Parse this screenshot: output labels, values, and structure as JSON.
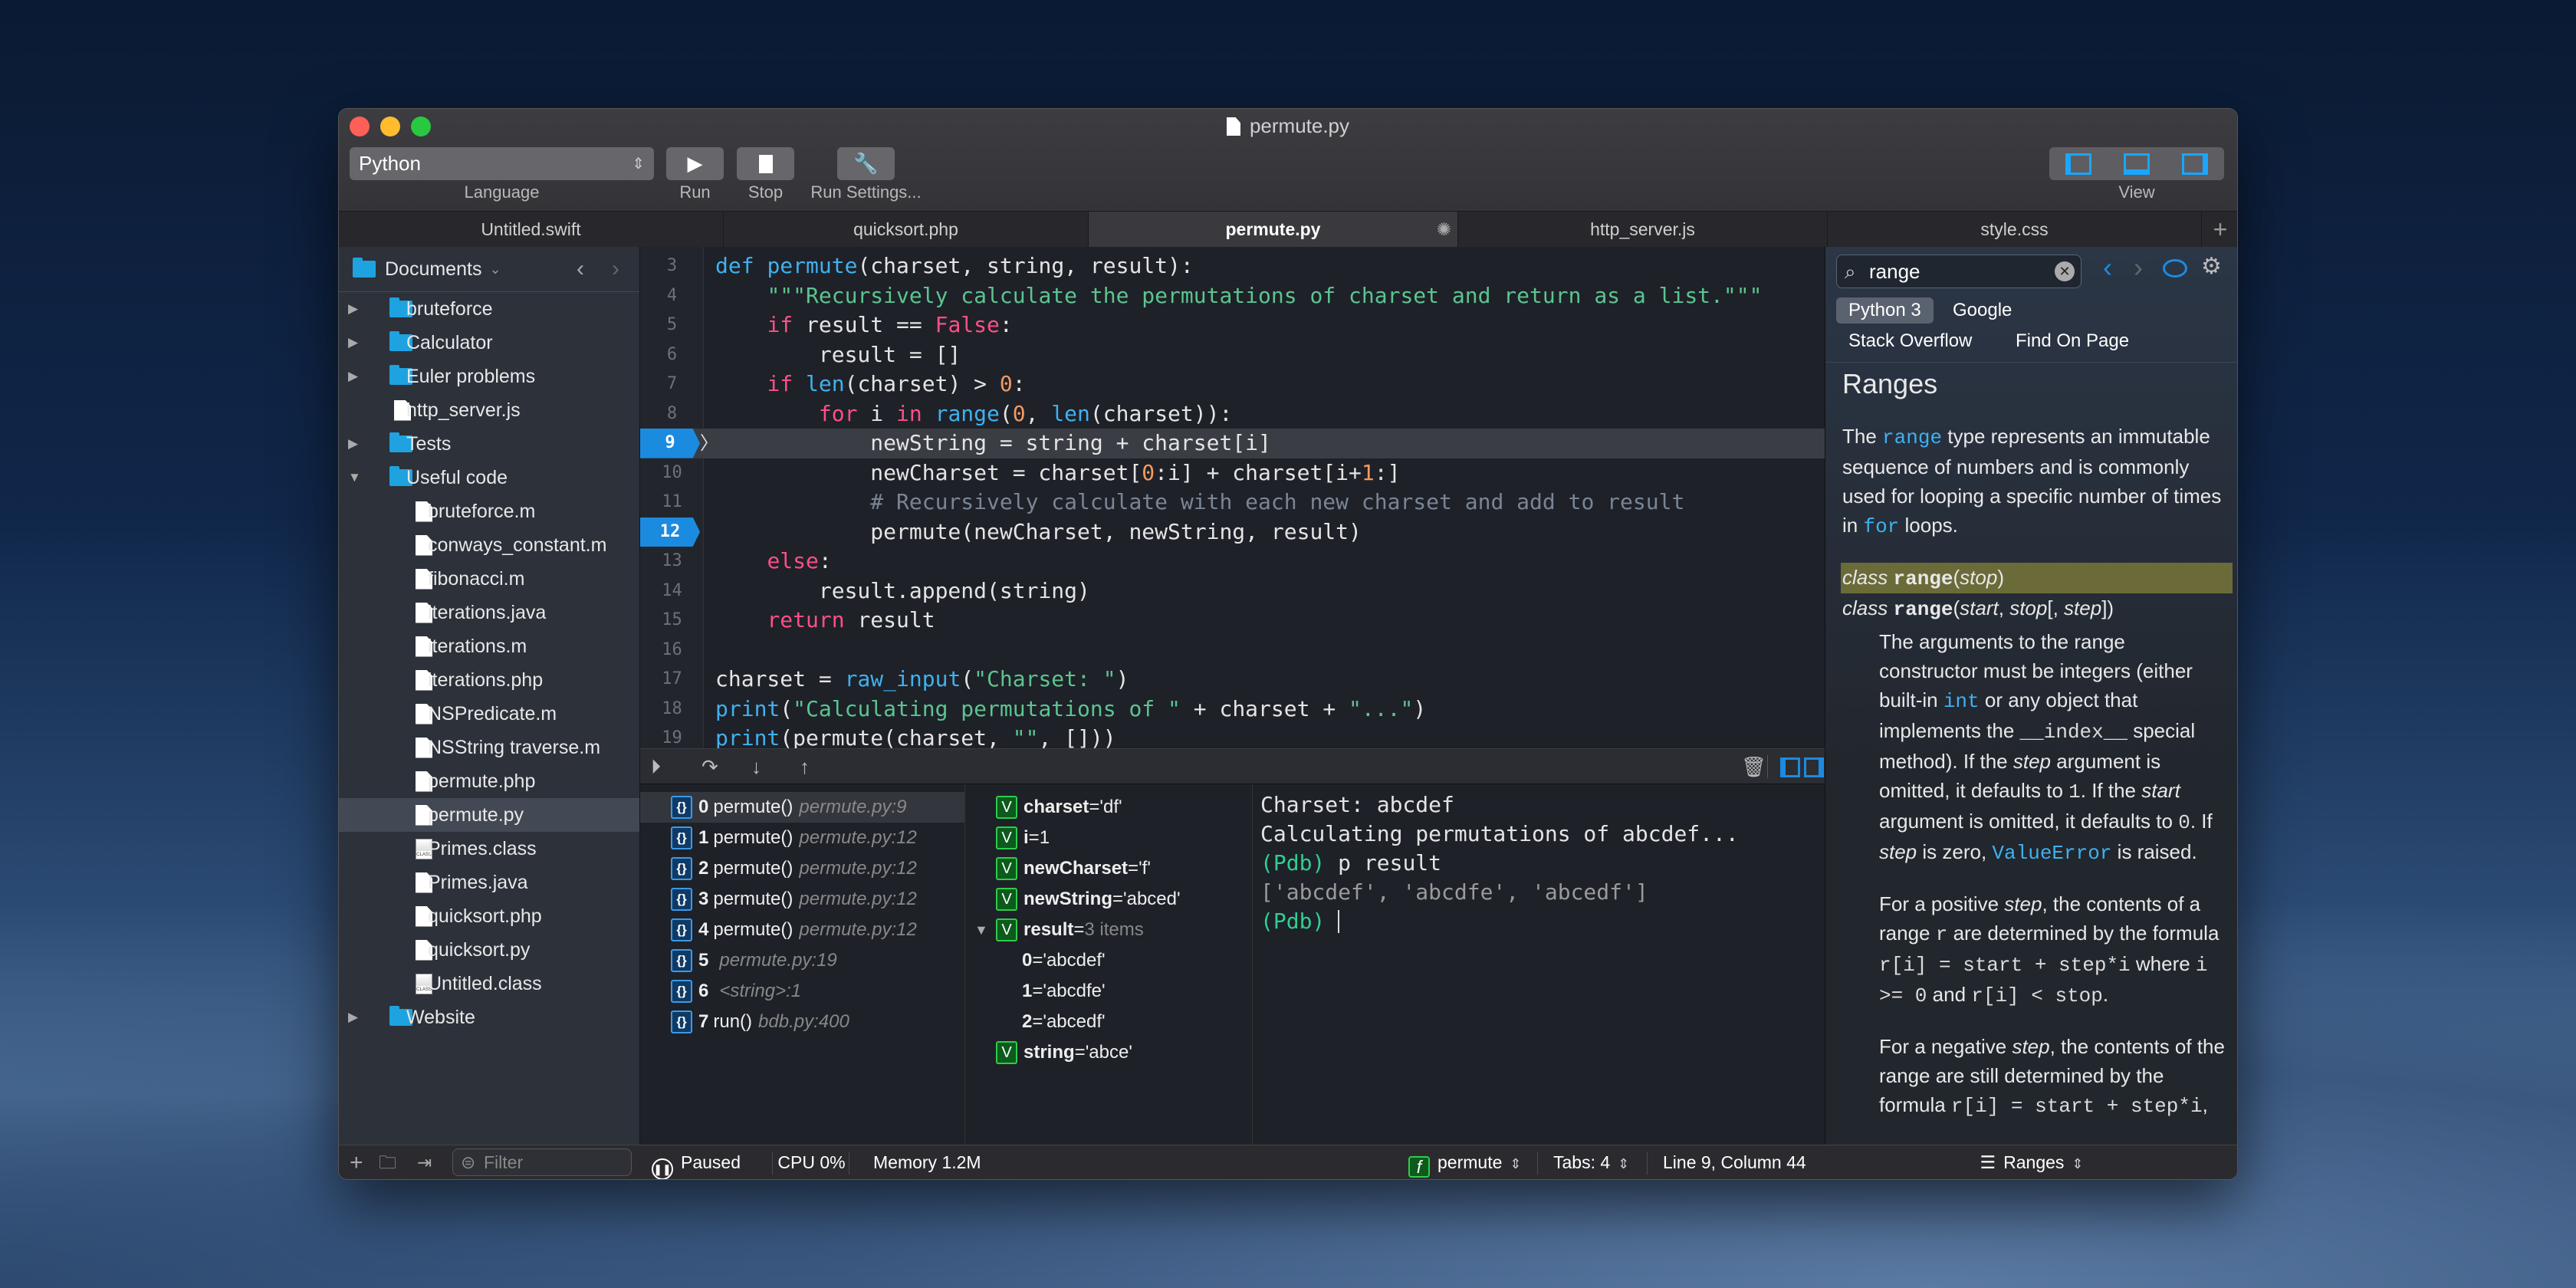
{
  "window": {
    "title": "permute.py"
  },
  "colors": {
    "accent": "#1b8be0",
    "keyword": "#ff4f87",
    "builtin": "#3fb1f0",
    "string": "#5cc490",
    "number": "#f39a5f",
    "comment": "#7a8594",
    "pdb_prompt": "#2fcf8f"
  },
  "toolbar": {
    "language_value": "Python",
    "language_label": "Language",
    "run_label": "Run",
    "stop_label": "Stop",
    "settings_label": "Run Settings...",
    "view_label": "View"
  },
  "tabs": [
    {
      "label": "Untitled.swift"
    },
    {
      "label": "quicksort.php"
    },
    {
      "label": "permute.py",
      "active": true
    },
    {
      "label": "http_server.js"
    },
    {
      "label": "style.css"
    }
  ],
  "sidebar": {
    "root": "Documents",
    "filter_placeholder": "Filter",
    "items": [
      {
        "label": "bruteforce",
        "type": "folder",
        "level": 0,
        "expanded": false
      },
      {
        "label": "Calculator",
        "type": "folder",
        "level": 0,
        "expanded": false
      },
      {
        "label": "Euler problems",
        "type": "folder",
        "level": 0,
        "expanded": false
      },
      {
        "label": "http_server.js",
        "type": "file",
        "level": 0
      },
      {
        "label": "Tests",
        "type": "folder",
        "level": 0,
        "expanded": false
      },
      {
        "label": "Useful code",
        "type": "folder",
        "level": 0,
        "expanded": true
      },
      {
        "label": "bruteforce.m",
        "type": "file",
        "level": 1
      },
      {
        "label": "conways_constant.m",
        "type": "file",
        "level": 1
      },
      {
        "label": "fibonacci.m",
        "type": "file",
        "level": 1
      },
      {
        "label": "iterations.java",
        "type": "file",
        "level": 1
      },
      {
        "label": "iterations.m",
        "type": "file",
        "level": 1
      },
      {
        "label": "iterations.php",
        "type": "file",
        "level": 1
      },
      {
        "label": "NSPredicate.m",
        "type": "file",
        "level": 1
      },
      {
        "label": "NSString traverse.m",
        "type": "file",
        "level": 1
      },
      {
        "label": "permute.php",
        "type": "file",
        "level": 1
      },
      {
        "label": "permute.py",
        "type": "file",
        "level": 1,
        "selected": true
      },
      {
        "label": "Primes.class",
        "type": "class",
        "level": 1
      },
      {
        "label": "Primes.java",
        "type": "file",
        "level": 1
      },
      {
        "label": "quicksort.php",
        "type": "file",
        "level": 1
      },
      {
        "label": "quicksort.py",
        "type": "file",
        "level": 1
      },
      {
        "label": "Untitled.class",
        "type": "class",
        "level": 1
      },
      {
        "label": "Website",
        "type": "folder",
        "level": 0,
        "expanded": false
      }
    ]
  },
  "editor": {
    "current_line": 9,
    "breakpoints": [
      9,
      12
    ],
    "lines": [
      {
        "n": 3,
        "t": [
          [
            "def",
            "f"
          ],
          [
            " "
          ],
          [
            "permute",
            "f"
          ],
          [
            "(charset, string, result):"
          ]
        ]
      },
      {
        "n": 4,
        "t": [
          [
            "    "
          ],
          [
            "\"\"\"Recursively calculate the permutations of charset and return as a list.\"\"\"",
            "s"
          ]
        ]
      },
      {
        "n": 5,
        "t": [
          [
            "    "
          ],
          [
            "if",
            "k"
          ],
          [
            " result == "
          ],
          [
            "False",
            "k"
          ],
          [
            ":"
          ]
        ]
      },
      {
        "n": 6,
        "t": [
          [
            "        result = []"
          ]
        ]
      },
      {
        "n": 7,
        "t": [
          [
            "    "
          ],
          [
            "if",
            "k"
          ],
          [
            " "
          ],
          [
            "len",
            "f"
          ],
          [
            "(charset) > "
          ],
          [
            "0",
            "n"
          ],
          [
            ":"
          ]
        ]
      },
      {
        "n": 8,
        "t": [
          [
            "        "
          ],
          [
            "for",
            "k"
          ],
          [
            " i "
          ],
          [
            "in",
            "k"
          ],
          [
            " "
          ],
          [
            "range",
            "f"
          ],
          [
            "("
          ],
          [
            "0",
            "n"
          ],
          [
            ", "
          ],
          [
            "len",
            "f"
          ],
          [
            "(charset)):"
          ]
        ]
      },
      {
        "n": 9,
        "t": [
          [
            "            newString = string + charset[i]"
          ]
        ]
      },
      {
        "n": 10,
        "t": [
          [
            "            newCharset = charset["
          ],
          [
            "0",
            "n"
          ],
          [
            ":i] + charset[i+"
          ],
          [
            "1",
            "n"
          ],
          [
            ":]"
          ]
        ]
      },
      {
        "n": 11,
        "t": [
          [
            "            "
          ],
          [
            "# Recursively calculate with each new charset and add to result",
            "c"
          ]
        ]
      },
      {
        "n": 12,
        "t": [
          [
            "            permute(newCharset, newString, result)"
          ]
        ]
      },
      {
        "n": 13,
        "t": [
          [
            "    "
          ],
          [
            "else",
            "k"
          ],
          [
            ":"
          ]
        ]
      },
      {
        "n": 14,
        "t": [
          [
            "        result.append(string)"
          ]
        ]
      },
      {
        "n": 15,
        "t": [
          [
            "    "
          ],
          [
            "return",
            "k"
          ],
          [
            " result"
          ]
        ]
      },
      {
        "n": 16,
        "t": [
          [
            ""
          ]
        ]
      },
      {
        "n": 17,
        "t": [
          [
            "charset = "
          ],
          [
            "raw_input",
            "f"
          ],
          [
            "("
          ],
          [
            "\"Charset: \"",
            "s"
          ],
          [
            ")"
          ]
        ]
      },
      {
        "n": 18,
        "t": [
          [
            "print",
            "f"
          ],
          [
            "("
          ],
          [
            "\"Calculating permutations of \"",
            "s"
          ],
          [
            " + charset + "
          ],
          [
            "\"...\"",
            "s"
          ],
          [
            ")"
          ]
        ]
      },
      {
        "n": 19,
        "t": [
          [
            "print",
            "f"
          ],
          [
            "(permute(charset, "
          ],
          [
            "\"\"",
            "s"
          ],
          [
            ", []))"
          ]
        ]
      }
    ]
  },
  "stack": [
    {
      "idx": "0",
      "fn": "permute()",
      "loc": "permute.py:9",
      "selected": true
    },
    {
      "idx": "1",
      "fn": "permute()",
      "loc": "permute.py:12"
    },
    {
      "idx": "2",
      "fn": "permute()",
      "loc": "permute.py:12"
    },
    {
      "idx": "3",
      "fn": "permute()",
      "loc": "permute.py:12"
    },
    {
      "idx": "4",
      "fn": "permute()",
      "loc": "permute.py:12"
    },
    {
      "idx": "5",
      "fn": "",
      "loc": "permute.py:19"
    },
    {
      "idx": "6",
      "fn": "",
      "loc": "<string>:1"
    },
    {
      "idx": "7",
      "fn": "run()",
      "loc": "bdb.py:400"
    }
  ],
  "variables": [
    {
      "name": "charset",
      "value": "'df'"
    },
    {
      "name": "i",
      "value": "1"
    },
    {
      "name": "newCharset",
      "value": "'f'"
    },
    {
      "name": "newString",
      "value": "'abced'"
    },
    {
      "name": "result",
      "value": "3 items",
      "expanded": true,
      "children": [
        {
          "name": "0",
          "value": "'abcdef'"
        },
        {
          "name": "1",
          "value": "'abcdfe'"
        },
        {
          "name": "2",
          "value": "'abcedf'"
        }
      ]
    },
    {
      "name": "string",
      "value": "'abce'"
    }
  ],
  "console": [
    {
      "text": "Charset: abcdef"
    },
    {
      "text": "Calculating permutations of abcdef..."
    },
    {
      "prompt": "(Pdb)",
      "text": " p result"
    },
    {
      "text": "['abcdef', 'abcdfe', 'abcedf']",
      "dim": true
    },
    {
      "prompt": "(Pdb)",
      "text": " ",
      "cursor": true
    }
  ],
  "docs": {
    "search_value": "range",
    "sources": [
      "Python 3",
      "Google",
      "Stack Overflow",
      "Find On Page"
    ],
    "active_source": "Python 3",
    "heading": "Ranges",
    "blocks": [
      {
        "type": "p",
        "seg": [
          [
            "The "
          ],
          [
            "range",
            "link"
          ],
          [
            " type represents an immutable sequence of numbers and is commonly used for looping a specific number of times in "
          ],
          [
            "for",
            "link"
          ],
          [
            " loops."
          ]
        ]
      },
      {
        "type": "sig",
        "hl": true,
        "seg": [
          [
            "class",
            "em"
          ],
          [
            " "
          ],
          [
            "range",
            "bcode"
          ],
          [
            "("
          ],
          [
            "stop",
            "em"
          ],
          [
            ")"
          ]
        ]
      },
      {
        "type": "sig",
        "seg": [
          [
            "class",
            "em"
          ],
          [
            " "
          ],
          [
            "range",
            "bcode"
          ],
          [
            "("
          ],
          [
            "start",
            "em"
          ],
          [
            ", "
          ],
          [
            "stop",
            "em"
          ],
          [
            "[, "
          ],
          [
            "step",
            "em"
          ],
          [
            "])"
          ]
        ]
      },
      {
        "type": "ind",
        "seg": [
          [
            "The arguments to the range constructor must be integers (either built-in "
          ],
          [
            "int",
            "link"
          ],
          [
            " or any object that implements the "
          ],
          [
            "__index__",
            "code"
          ],
          [
            " special method). If the "
          ],
          [
            "step",
            "em"
          ],
          [
            " argument is omitted, it defaults to "
          ],
          [
            "1",
            "code"
          ],
          [
            ". If the "
          ],
          [
            "start",
            "em"
          ],
          [
            " argument is omitted, it defaults to "
          ],
          [
            "0",
            "code"
          ],
          [
            ". If "
          ],
          [
            "step",
            "em"
          ],
          [
            " is zero, "
          ],
          [
            "ValueError",
            "link"
          ],
          [
            " is raised."
          ]
        ]
      },
      {
        "type": "ind",
        "seg": [
          [
            "For a positive "
          ],
          [
            "step",
            "em"
          ],
          [
            ", the contents of a range "
          ],
          [
            "r",
            "code"
          ],
          [
            " are determined by the formula "
          ],
          [
            "r[i] = start + step*i",
            "code"
          ],
          [
            " where "
          ],
          [
            "i >= 0",
            "code"
          ],
          [
            " and "
          ],
          [
            "r[i] < stop",
            "code"
          ],
          [
            "."
          ]
        ]
      },
      {
        "type": "ind",
        "seg": [
          [
            "For a negative "
          ],
          [
            "step",
            "em"
          ],
          [
            ", the contents of the range are still determined by the formula "
          ],
          [
            "r[i] = start + step*i",
            "code"
          ],
          [
            ","
          ]
        ]
      }
    ],
    "footer": "Ranges"
  },
  "status": {
    "state": "Paused",
    "cpu": "CPU 0%",
    "memory": "Memory 1.2M",
    "function": "permute",
    "tabs": "Tabs: 4",
    "position": "Line 9, Column 44"
  }
}
